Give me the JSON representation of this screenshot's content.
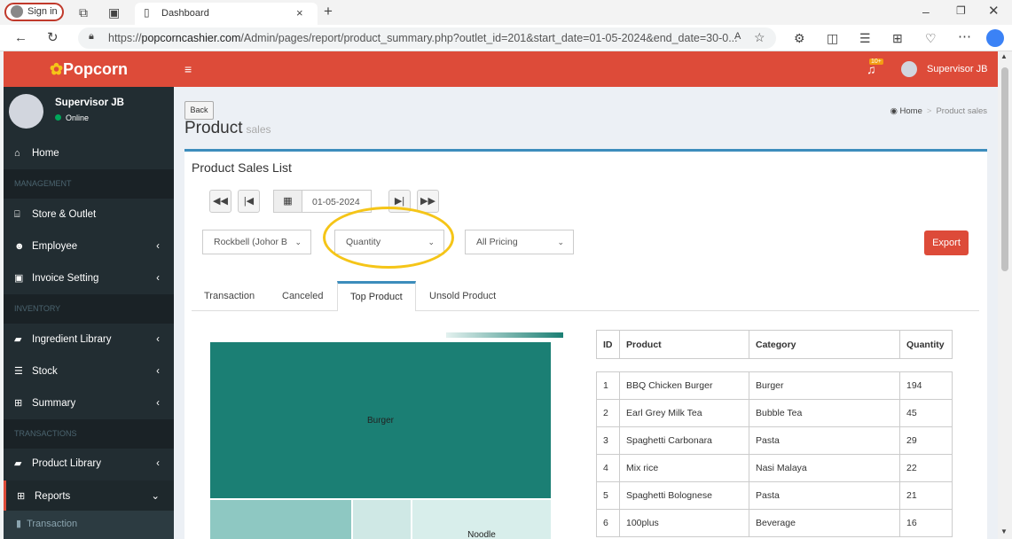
{
  "browser": {
    "sign_in": "Sign in",
    "tab_title": "Dashboard",
    "url_prefix": "https://",
    "url_domain": "popcorncashier.com",
    "url_rest": "/Admin/pages/report/product_summary.php?outlet_id=201&start_date=01-05-2024&end_date=30-0..."
  },
  "app": {
    "logo": "Popcorn",
    "notification_badge": "10+",
    "header_user": "Supervisor JB"
  },
  "sidebar": {
    "user_name": "Supervisor JB",
    "user_status": "Online",
    "home": "Home",
    "header_management": "MANAGEMENT",
    "store_outlet": "Store & Outlet",
    "employee": "Employee",
    "invoice_setting": "Invoice Setting",
    "header_inventory": "INVENTORY",
    "ingredient_library": "Ingredient Library",
    "stock": "Stock",
    "summary": "Summary",
    "header_transactions": "TRANSACTIONS",
    "product_library": "Product Library",
    "reports": "Reports",
    "transaction_sub": "Transaction"
  },
  "page": {
    "back": "Back",
    "title": "Product",
    "subtitle": "sales",
    "breadcrumb_home": "Home",
    "breadcrumb_current": "Product sales",
    "box_title": "Product Sales List",
    "date": "01-05-2024",
    "outlet_select": "Rockbell (Johor B",
    "metric_select": "Quantity",
    "pricing_select": "All Pricing",
    "export": "Export"
  },
  "tabs": [
    "Transaction",
    "Canceled",
    "Top Product",
    "Unsold Product"
  ],
  "active_tab": "Top Product",
  "treemap": {
    "labels": [
      "Burger",
      "Noodle"
    ],
    "colors": {
      "burger": "#1b7f74",
      "pasta": "#8ec8c2",
      "small": "#cfe8e5",
      "noodle": "#d8eeeb"
    }
  },
  "table": {
    "headers": [
      "ID",
      "Product",
      "Category",
      "Quantity"
    ],
    "rows": [
      [
        "1",
        "BBQ Chicken Burger",
        "Burger",
        "194"
      ],
      [
        "2",
        "Earl Grey Milk Tea",
        "Bubble Tea",
        "45"
      ],
      [
        "3",
        "Spaghetti Carbonara",
        "Pasta",
        "29"
      ],
      [
        "4",
        "Mix rice",
        "Nasi Malaya",
        "22"
      ],
      [
        "5",
        "Spaghetti Bolognese",
        "Pasta",
        "21"
      ],
      [
        "6",
        "100plus",
        "Beverage",
        "16"
      ]
    ]
  },
  "colors": {
    "brand": "#dd4b39",
    "sidebar": "#222d32",
    "accent": "#3c8dbc",
    "highlight": "#f5c518"
  }
}
